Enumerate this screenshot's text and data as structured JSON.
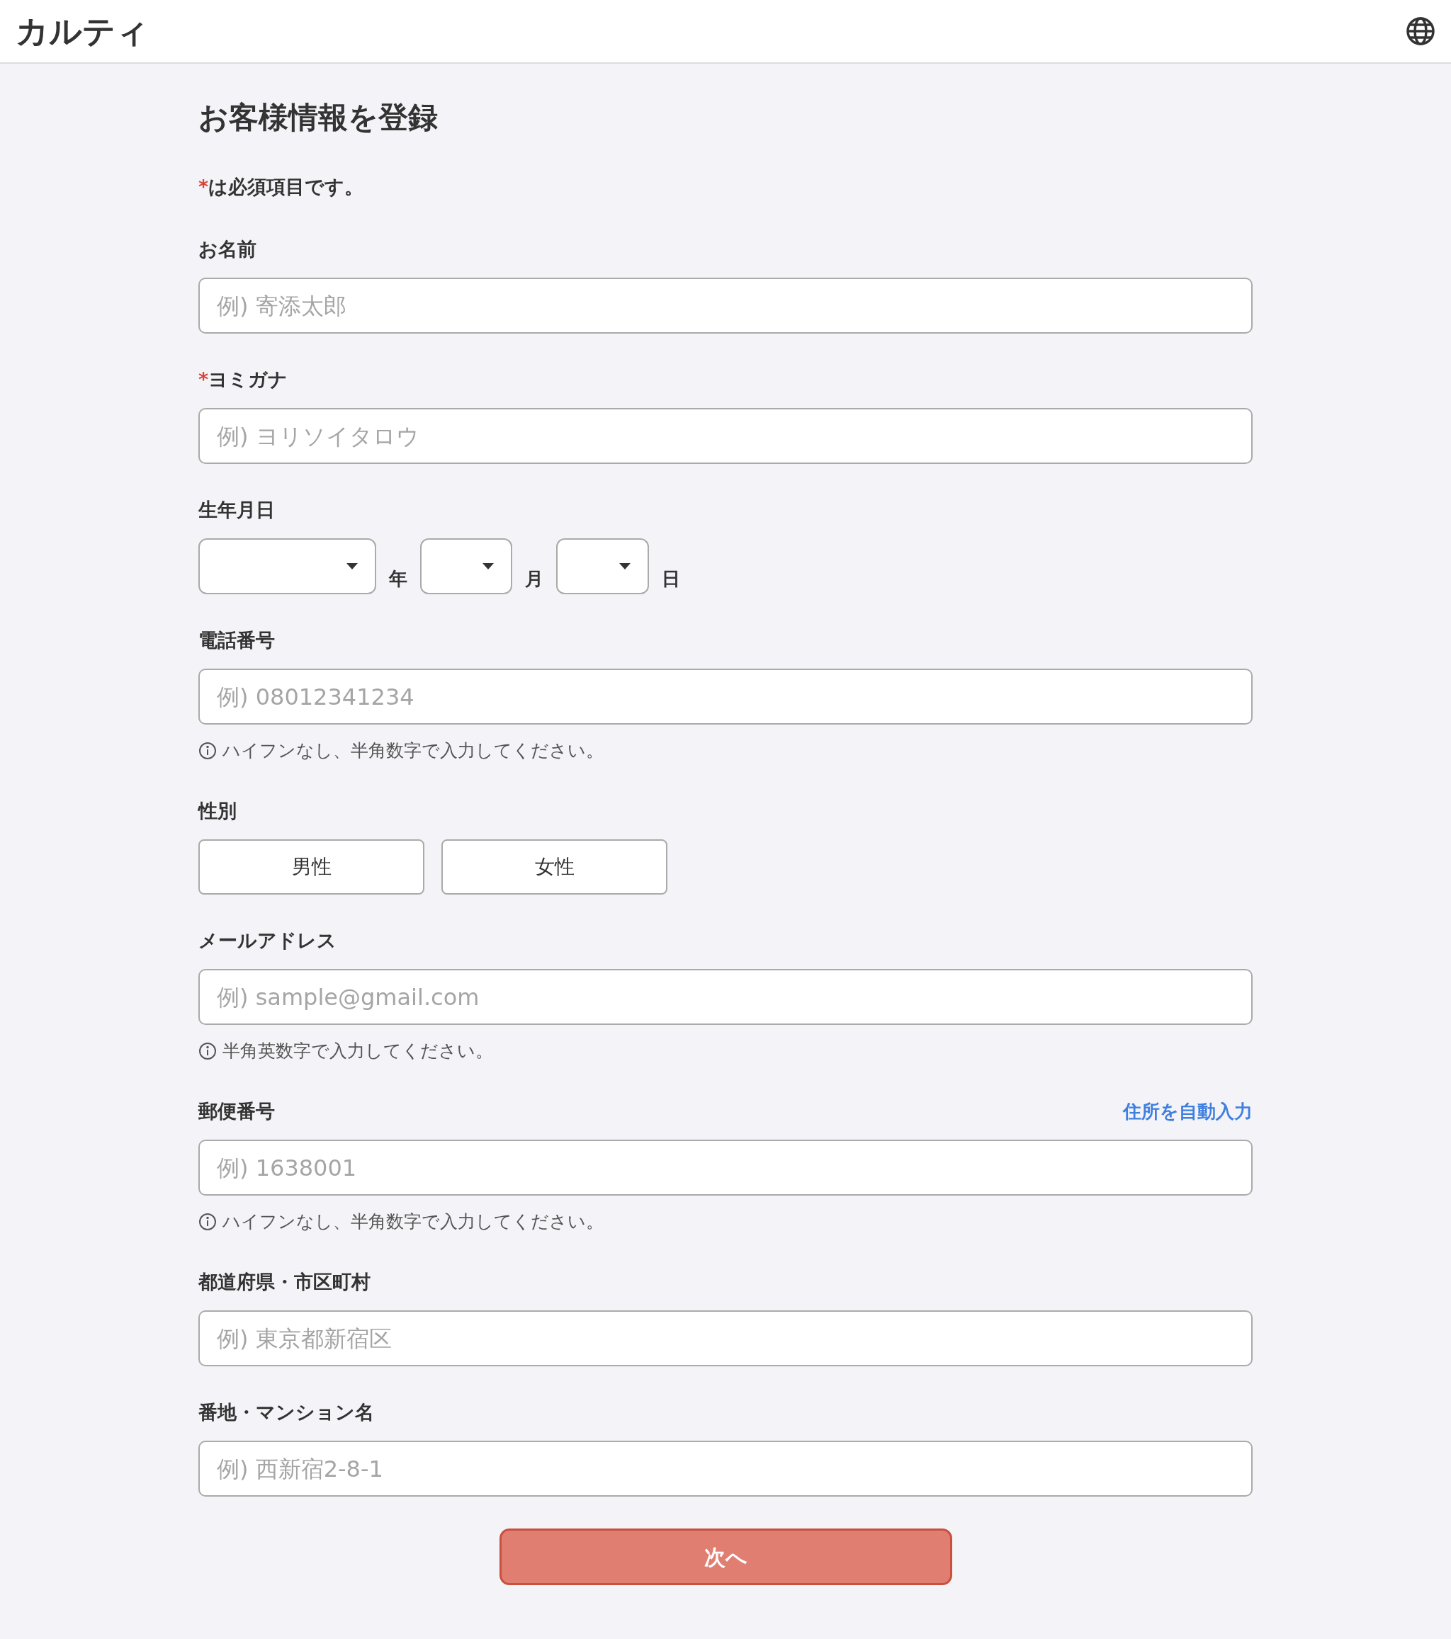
{
  "header": {
    "logo": "カルティ"
  },
  "form": {
    "title": "お客様情報を登録",
    "note": {
      "mark": "*",
      "text": "は必須項目です。"
    },
    "fields": [
      {
        "kind": "text",
        "label": "お名前",
        "placeholder": "例) 寄添太郎"
      },
      {
        "kind": "text",
        "label": "ヨミガナ",
        "mark": "*",
        "placeholder": "例) ヨリソイタロウ"
      },
      {
        "kind": "date",
        "label": "生年月日",
        "parts": [
          {
            "unit": "年"
          },
          {
            "unit": "月"
          },
          {
            "unit": "日"
          }
        ]
      },
      {
        "kind": "text",
        "label": "電話番号",
        "placeholder": "例) 08012341234",
        "hint": "ハイフンなし、半角数字で入力してください。"
      },
      {
        "kind": "choice",
        "label": "性別",
        "options": [
          {
            "label": "男性",
            "selected": false
          },
          {
            "label": "女性",
            "selected": false
          }
        ]
      },
      {
        "kind": "text",
        "label": "メールアドレス",
        "placeholder": "例) sample@gmail.com",
        "hint": "半角英数字で入力してください。"
      },
      {
        "kind": "text",
        "label": "郵便番号",
        "action_link": "住所を自動入力",
        "placeholder": "例) 1638001",
        "hint": "ハイフンなし、半角数字で入力してください。"
      },
      {
        "kind": "text",
        "label": "都道府県・市区町村",
        "placeholder": "例) 東京都新宿区"
      },
      {
        "kind": "text",
        "label": "番地・マンション名",
        "placeholder": "例) 西新宿2-8-1"
      }
    ],
    "submit": "次へ"
  }
}
